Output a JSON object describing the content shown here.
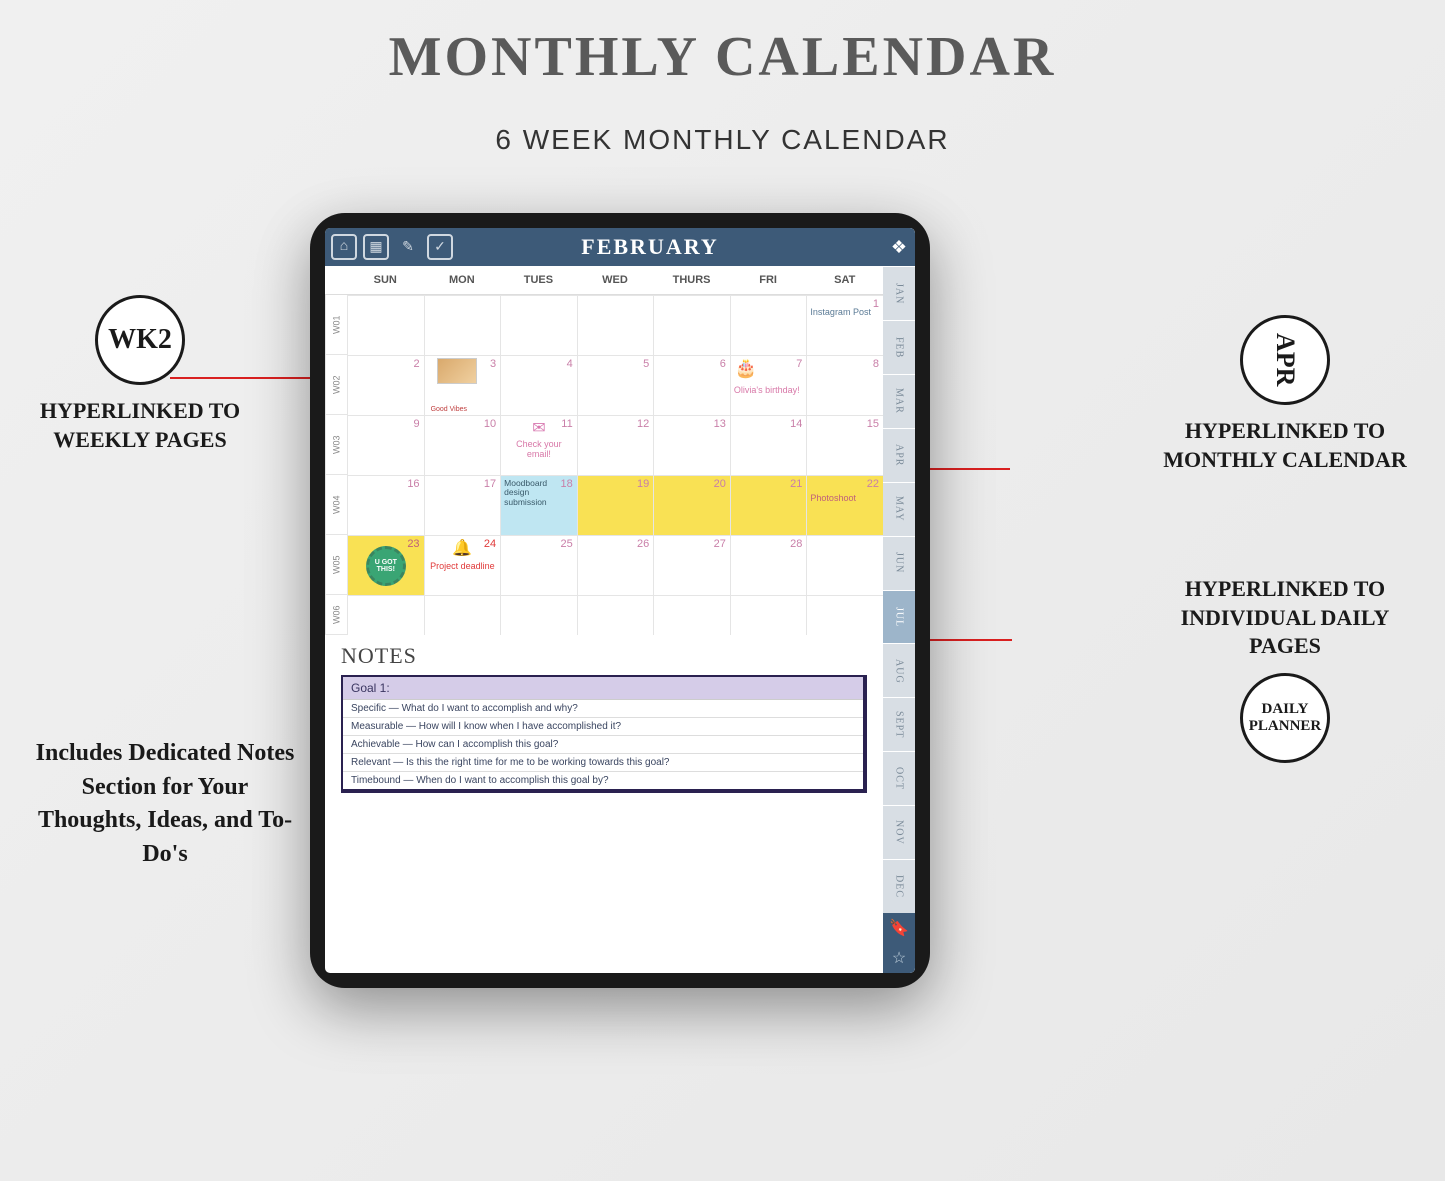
{
  "page": {
    "title": "MONTHLY CALENDAR",
    "subtitle": "6 WEEK MONTHLY CALENDAR"
  },
  "planner": {
    "month_label": "FEBRUARY",
    "day_headers": [
      "SUN",
      "MON",
      "TUES",
      "WED",
      "THURS",
      "FRI",
      "SAT"
    ],
    "week_labels": [
      "W01",
      "W02",
      "W03",
      "W04",
      "W05",
      "W06"
    ],
    "notes_title": "NOTES",
    "month_tabs": [
      "JAN",
      "FEB",
      "MAR",
      "APR",
      "MAY",
      "JUN",
      "JUL",
      "AUG",
      "SEPT",
      "OCT",
      "NOV",
      "DEC"
    ],
    "active_tab_index": 6,
    "cells": {
      "w1": {
        "sat_num": "1",
        "sat_text": "Instagram Post"
      },
      "w2": {
        "sun": "2",
        "mon": "3",
        "mon_text": "Good Vibes",
        "tue": "4",
        "wed": "5",
        "thu": "6",
        "fri": "7",
        "fri_text": "Olivia's birthday!",
        "sat": "8"
      },
      "w3": {
        "sun": "9",
        "mon": "10",
        "tue": "11",
        "tue_text": "Check your email!",
        "wed": "12",
        "thu": "13",
        "fri": "14",
        "sat": "15"
      },
      "w4": {
        "sun": "16",
        "mon": "17",
        "tue": "18",
        "tue_text": "Moodboard design submission",
        "wed": "19",
        "thu": "20",
        "fri": "21",
        "sat": "22",
        "sat_text": "Photoshoot"
      },
      "w5": {
        "sun": "23",
        "sun_text": "U GOT THIS!",
        "mon": "24",
        "mon_text": "Project deadline",
        "tue": "25",
        "wed": "26",
        "thu": "27",
        "fri": "28"
      },
      "w6": {}
    },
    "goal": {
      "header": "Goal 1:",
      "lines": [
        "Specific — What do I want to accomplish and why?",
        "Measurable — How will I know when I have accomplished it?",
        "Achievable — How can I accomplish this goal?",
        "Relevant — Is this the right time for me to be working towards this goal?",
        "Timebound — When do I want to accomplish this goal by?"
      ]
    }
  },
  "callouts": {
    "wk2_badge": "WK2",
    "wk2_text": "HYPERLINKED TO WEEKLY PAGES",
    "apr_badge": "APR",
    "apr_text": "HYPERLINKED TO MONTHLY CALENDAR",
    "daily_text": "HYPERLINKED TO INDIVIDUAL DAILY PAGES",
    "daily_badge": "DAILY PLANNER",
    "notes_desc": "Includes Dedicated Notes Section for Your Thoughts, Ideas, and To-Do's"
  }
}
